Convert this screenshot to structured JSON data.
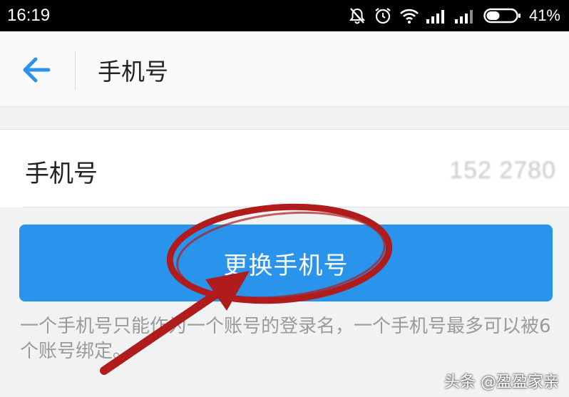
{
  "status_bar": {
    "time": "16:19",
    "battery": "41%",
    "icons": [
      "notifications-off-icon",
      "alarm-icon",
      "wifi-icon",
      "signal-icon",
      "signal-icon",
      "battery-icon"
    ]
  },
  "header": {
    "back_icon": "arrow-left-icon",
    "title": "手机号"
  },
  "phone_row": {
    "label": "手机号",
    "value": "152 2780"
  },
  "change_button": {
    "label": "更换手机号"
  },
  "hint": "一个手机号只能作为一个账号的登录名，一个手机号最多可以被6个账号绑定。",
  "watermark": "头条 @盈盈家亲",
  "colors": {
    "accent": "#2a94ec",
    "annotation": "#b01c1c"
  }
}
